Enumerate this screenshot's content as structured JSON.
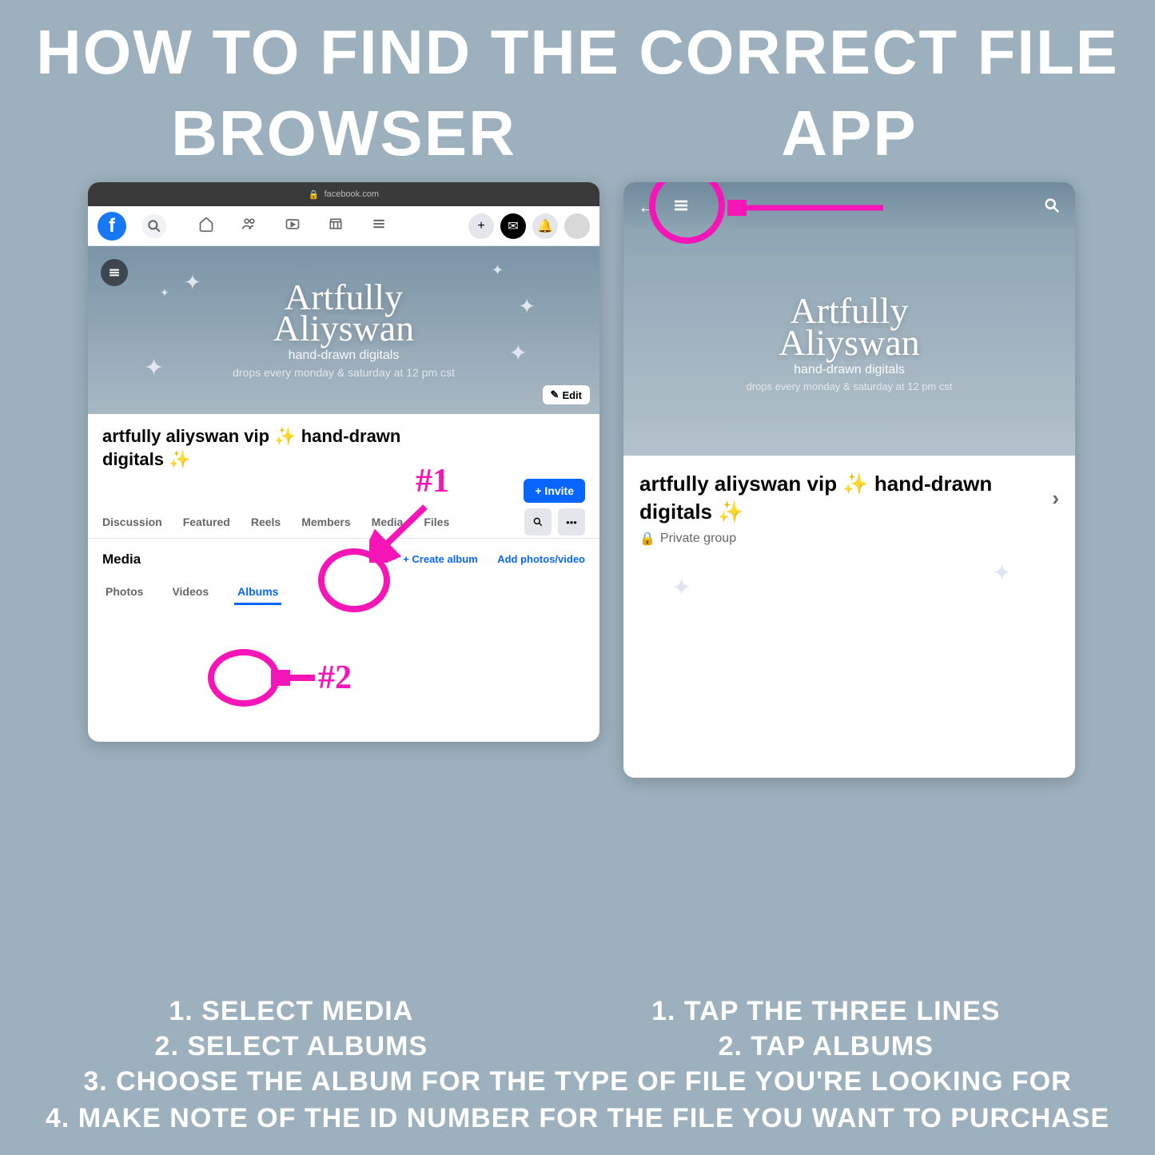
{
  "title": "HOW TO FIND THE CORRECT FILE",
  "columns": {
    "browser_heading": "BROWSER",
    "app_heading": "APP"
  },
  "browser": {
    "url_label": "facebook.com",
    "logo_letter": "f",
    "edit_btn": "Edit",
    "cover": {
      "brand_line1": "Artfully",
      "brand_line2": "Aliyswan",
      "tagline": "hand-drawn digitals",
      "drops": "drops every monday & saturday at 12 pm cst"
    },
    "group_title": "artfully aliyswan vip ✨ hand-drawn digitals ✨",
    "invite": "+ Invite",
    "tabs": [
      "Discussion",
      "Featured",
      "Reels",
      "Members",
      "Media",
      "Files"
    ],
    "media_title": "Media",
    "create_album": "+  Create album",
    "add_photos": "Add photos/video",
    "subtabs": {
      "photos": "Photos",
      "videos": "Videos",
      "albums": "Albums"
    }
  },
  "app": {
    "cover": {
      "brand_line1": "Artfully",
      "brand_line2": "Aliyswan",
      "tagline": "hand-drawn digitals",
      "drops": "drops every monday & saturday at 12 pm cst"
    },
    "group_title": "artfully aliyswan vip ✨ hand-drawn digitals ✨",
    "privacy": "Private group"
  },
  "annotations": {
    "label1": "#1",
    "label2": "#2"
  },
  "instructions": {
    "browser": [
      "1. SELECT MEDIA",
      "2. SELECT ALBUMS"
    ],
    "app": [
      "1. TAP THE THREE LINES",
      "2. TAP ALBUMS"
    ],
    "shared": [
      "3. CHOOSE THE ALBUM FOR THE TYPE OF FILE YOU'RE LOOKING FOR",
      "4. MAKE NOTE OF THE ID NUMBER FOR THE FILE YOU WANT TO PURCHASE"
    ]
  }
}
